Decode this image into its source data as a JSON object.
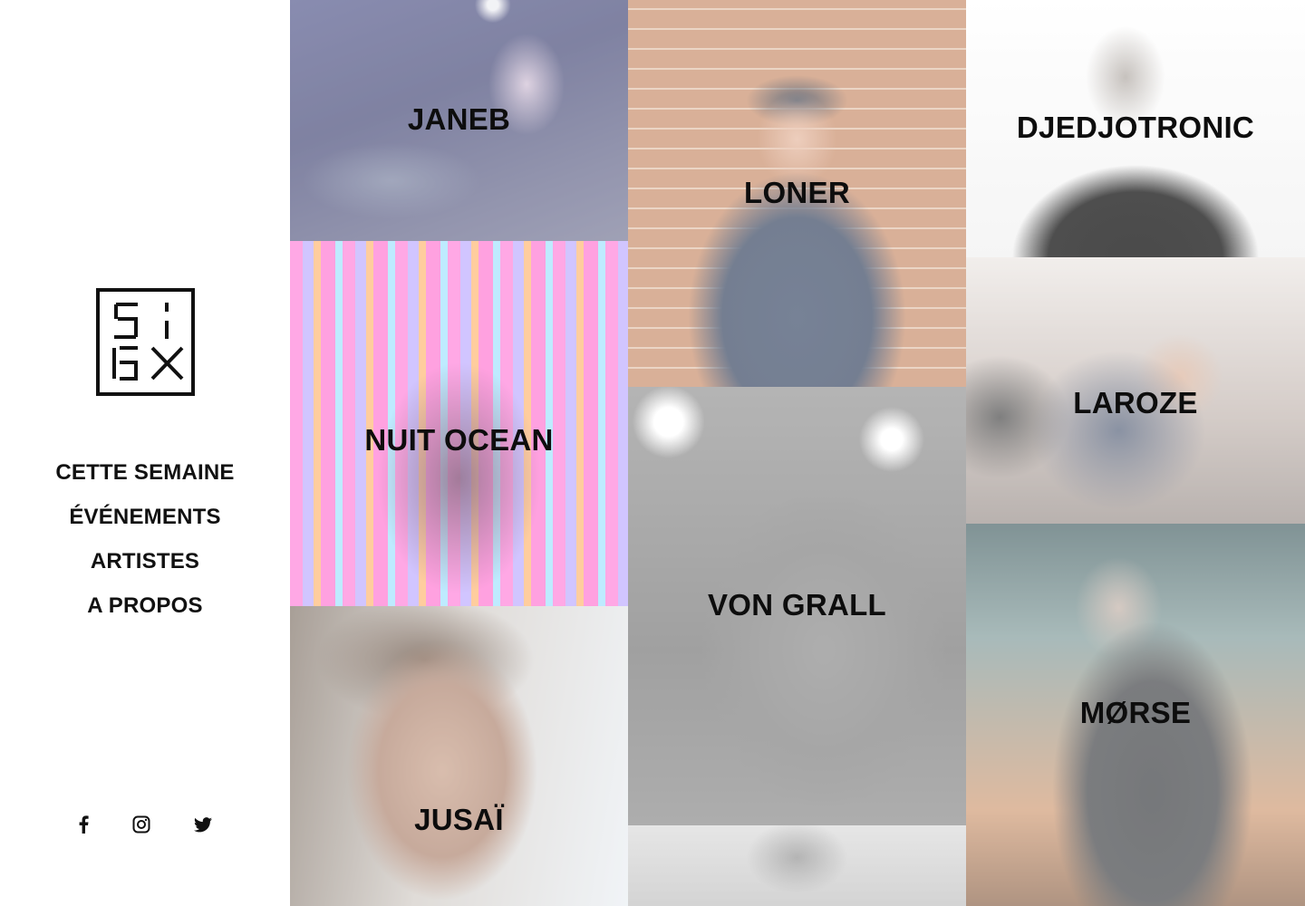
{
  "brand": {
    "logo_alt": "SIBX logo",
    "logo_text": "SIBX"
  },
  "nav": {
    "items": [
      {
        "label": "CETTE SEMAINE"
      },
      {
        "label": "ÉVÉNEMENTS"
      },
      {
        "label": "ARTISTES"
      },
      {
        "label": "A PROPOS"
      }
    ]
  },
  "social": {
    "facebook_icon": "facebook-icon",
    "instagram_icon": "instagram-icon",
    "twitter_icon": "twitter-icon"
  },
  "artists": [
    {
      "name": "JANEB"
    },
    {
      "name": "NUIT OCEAN"
    },
    {
      "name": "JUSAÏ"
    },
    {
      "name": "LONER"
    },
    {
      "name": "VON GRALL"
    },
    {
      "name": ""
    },
    {
      "name": "DJEDJOTRONIC"
    },
    {
      "name": "LAROZE"
    },
    {
      "name": "MØRSE"
    }
  ]
}
